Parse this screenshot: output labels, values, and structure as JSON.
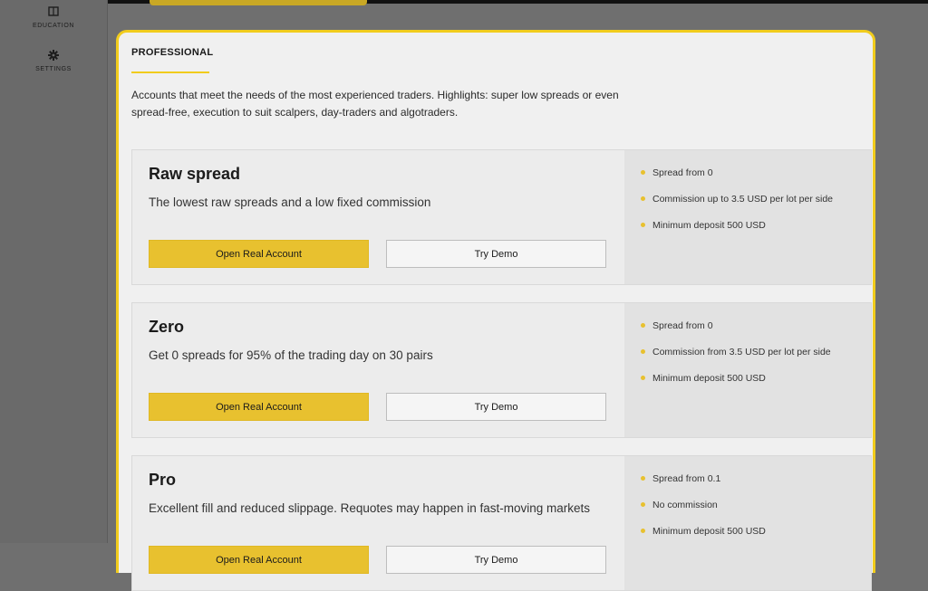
{
  "sidebar": {
    "items": [
      {
        "label": "EDUCATION",
        "icon": "book-icon"
      },
      {
        "label": "SETTINGS",
        "icon": "gear-icon"
      }
    ]
  },
  "panel": {
    "title": "PROFESSIONAL",
    "intro": "Accounts that meet the needs of the most experienced traders. Highlights: super low spreads or even spread-free, execution to suit scalpers, day-traders and algotraders."
  },
  "cards": [
    {
      "name": "Raw spread",
      "description": "The lowest raw spreads and a low fixed commission",
      "real_label": "Open Real Account",
      "demo_label": "Try Demo",
      "features": [
        "Spread from 0",
        "Commission up to 3.5 USD per lot per side",
        "Minimum deposit 500 USD"
      ]
    },
    {
      "name": "Zero",
      "description": "Get 0 spreads for 95% of the trading day on 30 pairs",
      "real_label": "Open Real Account",
      "demo_label": "Try Demo",
      "features": [
        "Spread from 0",
        "Commission from 3.5 USD per lot per side",
        "Minimum deposit 500 USD"
      ]
    },
    {
      "name": "Pro",
      "description": "Excellent fill and reduced slippage. Requotes may happen in fast-moving markets",
      "real_label": "Open Real Account",
      "demo_label": "Try Demo",
      "features": [
        "Spread from 0.1",
        "No commission",
        "Minimum deposit 500 USD"
      ]
    }
  ],
  "colors": {
    "accent": "#f1cc1d",
    "button": "#e8c12f",
    "panel_bg": "#f0f0f0",
    "page_bg": "#6f6f6f"
  }
}
